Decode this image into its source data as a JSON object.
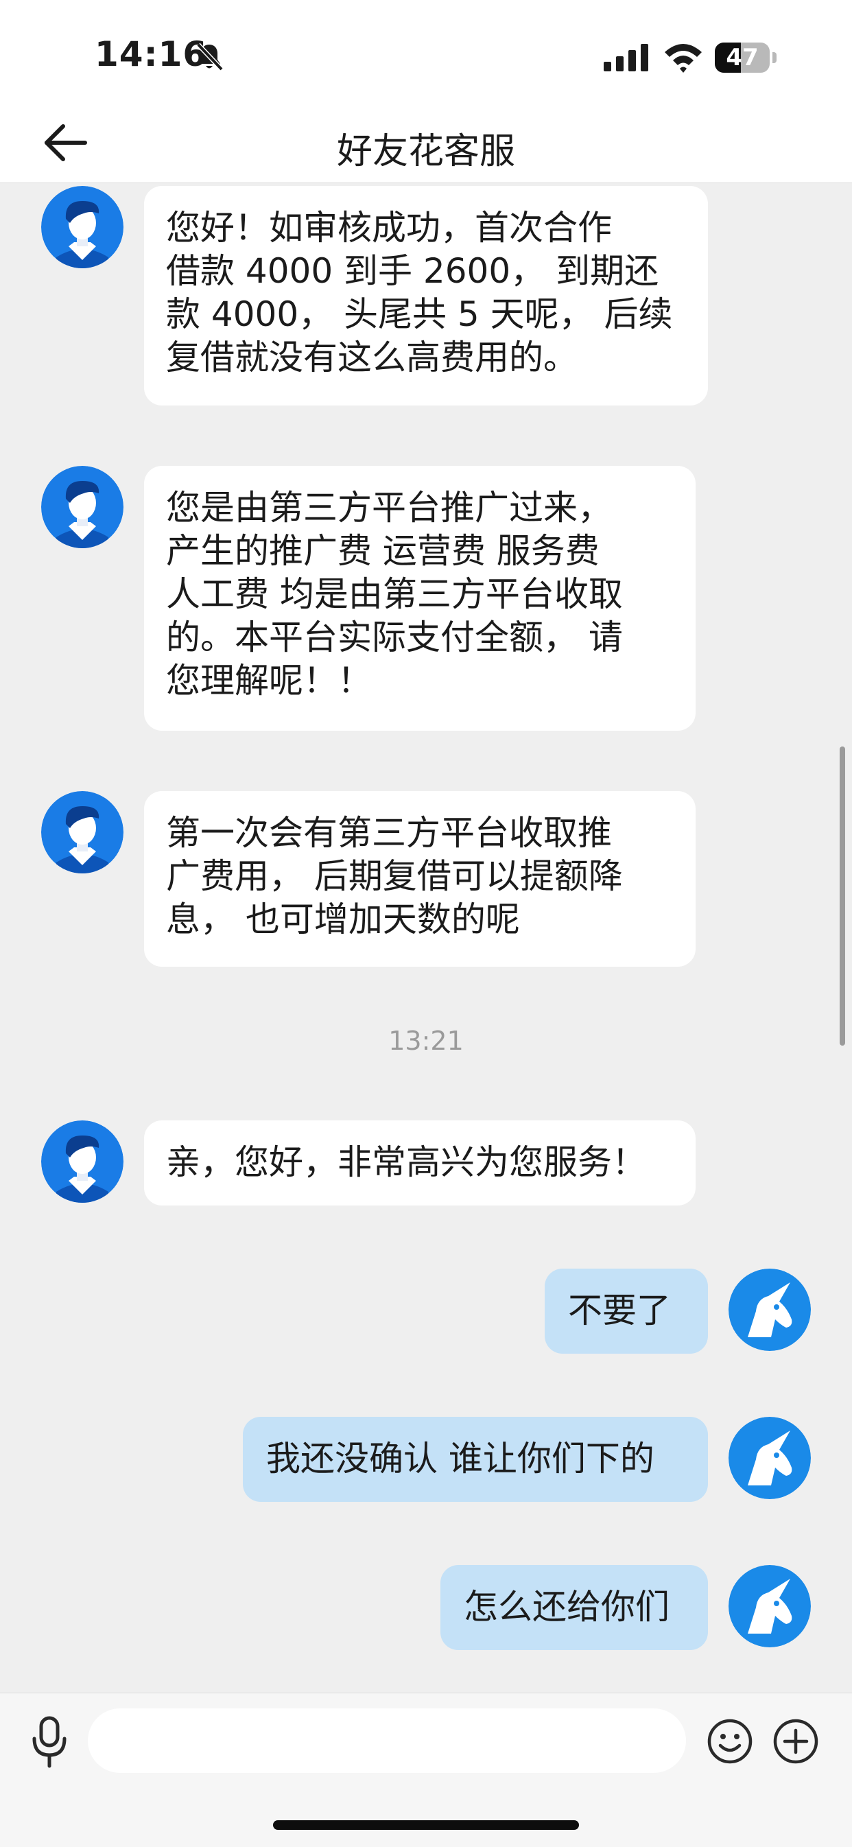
{
  "status": {
    "time": "14:16",
    "battery": "47",
    "battery_level": 0.47
  },
  "nav": {
    "title": "好友花客服"
  },
  "messages": [
    {
      "from": "agent",
      "lines": [
        "您好！如审核成功，首次合作",
        "借款 4000 到手 2600， 到期还",
        "款 4000， 头尾共 5 天呢， 后续",
        "复借就没有这么高费用的。"
      ]
    },
    {
      "from": "agent",
      "lines": [
        "您是由第三方平台推广过来，",
        "产生的推广费  运营费  服务费",
        "人工费 均是由第三方平台收取",
        "的。本平台实际支付全额，  请",
        "您理解呢！！"
      ]
    },
    {
      "from": "agent",
      "lines": [
        "第一次会有第三方平台收取推",
        "广费用， 后期复借可以提额降",
        "息， 也可增加天数的呢"
      ]
    },
    {
      "timestamp": "13:21"
    },
    {
      "from": "agent",
      "lines": [
        "亲，您好，非常高兴为您服务！"
      ]
    },
    {
      "from": "user",
      "lines": [
        "不要了"
      ]
    },
    {
      "from": "user",
      "lines": [
        "我还没确认 谁让你们下的"
      ]
    },
    {
      "from": "user",
      "lines": [
        "怎么还给你们"
      ]
    }
  ],
  "input": {
    "value": "",
    "placeholder": ""
  },
  "colors": {
    "agent_avatar": "#1a7ce6",
    "user_avatar": "#1a8ae8",
    "outgoing_bubble": "#c4e1f7",
    "incoming_bubble": "#ffffff"
  }
}
